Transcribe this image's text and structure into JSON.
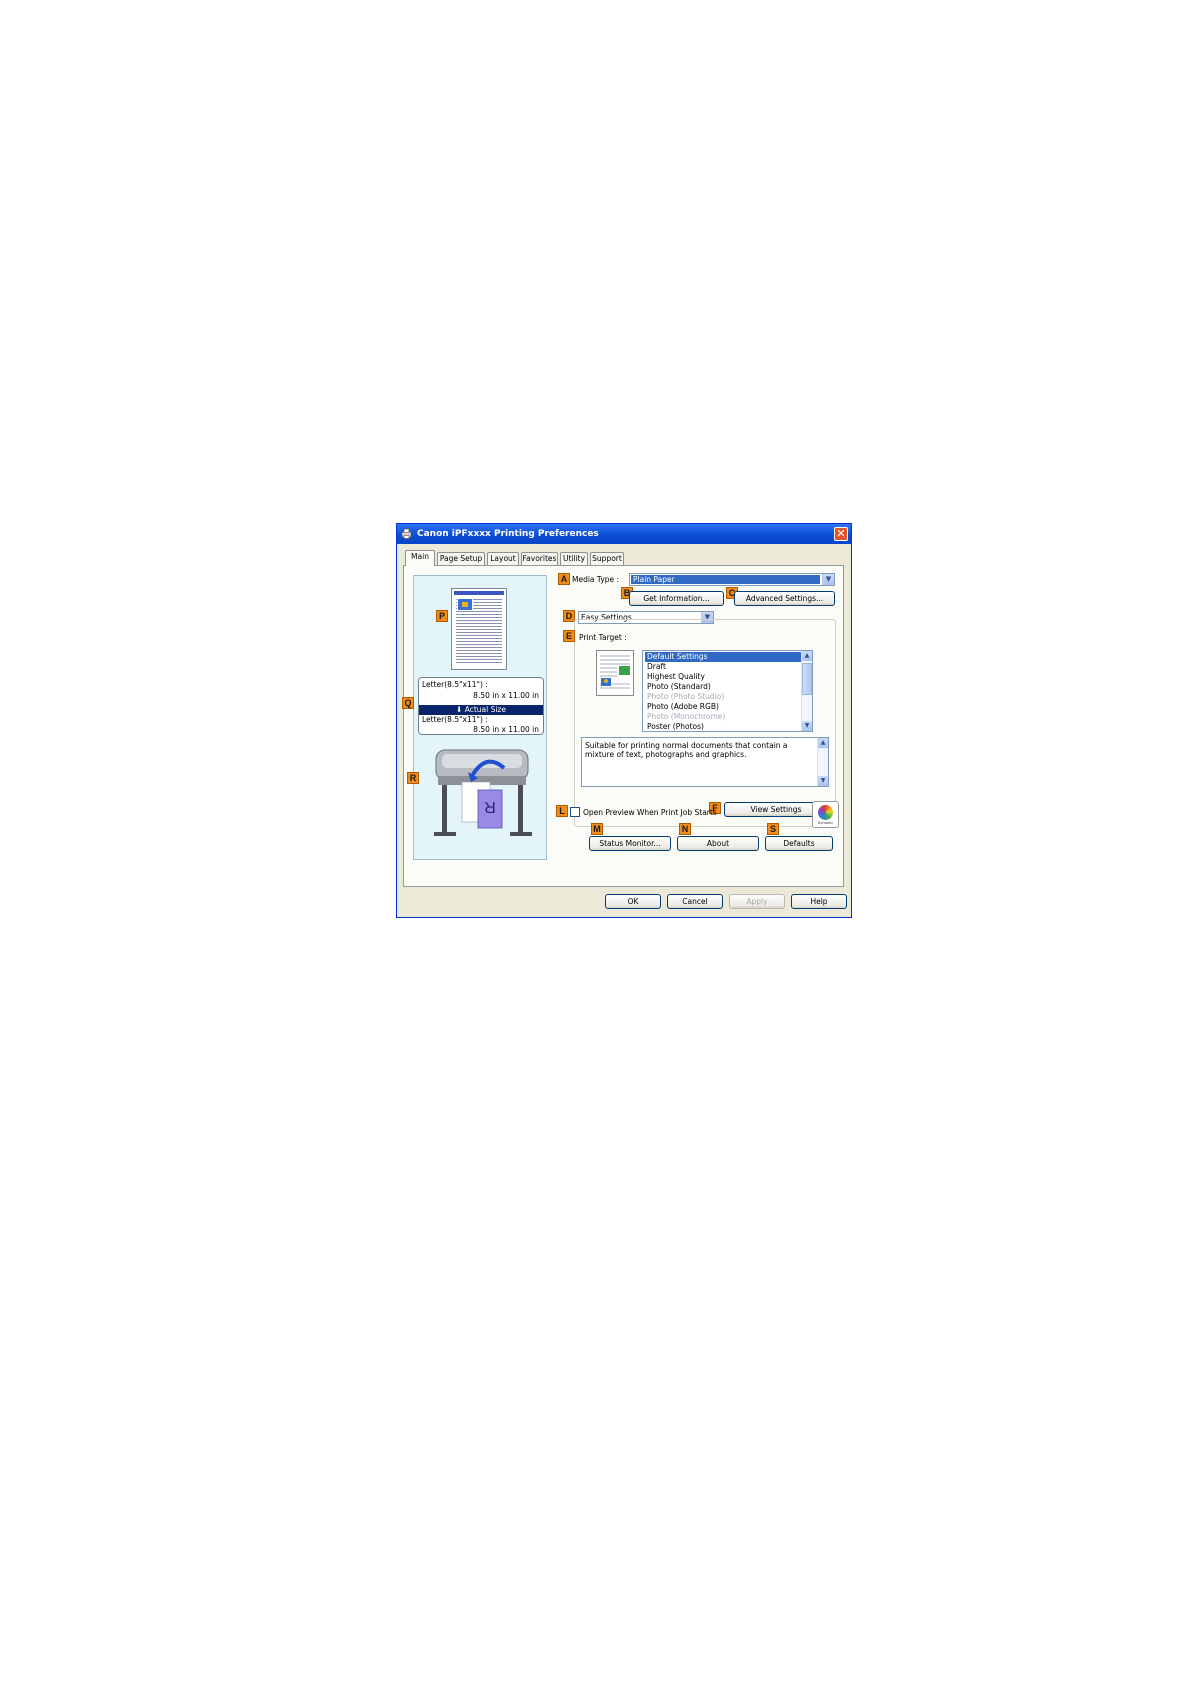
{
  "window": {
    "title": "Canon iPFxxxx Printing Preferences",
    "close_glyph": "✕"
  },
  "tabs": [
    {
      "label": "Main"
    },
    {
      "label": "Page Setup"
    },
    {
      "label": "Layout"
    },
    {
      "label": "Favorites"
    },
    {
      "label": "Utility"
    },
    {
      "label": "Support"
    }
  ],
  "markers": {
    "a": "A",
    "b": "B",
    "c": "C",
    "d": "D",
    "e": "E",
    "f": "F",
    "l": "L",
    "m": "M",
    "n": "N",
    "s": "S",
    "p": "P",
    "q": "Q",
    "r": "R"
  },
  "left_pane": {
    "original_size_label": "Letter(8.5\"x11\") :",
    "original_size_value": "8.50 in x 11.00 in",
    "scaling_label": "Actual Size",
    "scaling_arrow": "⬇",
    "output_size_label": "Letter(8.5\"x11\") :",
    "output_size_value": "8.50 in x 11.00 in",
    "printer_letter": "R"
  },
  "media_type": {
    "label": "Media Type :",
    "value": "Plain Paper"
  },
  "buttons": {
    "get_information": "Get Information...",
    "advanced_settings": "Advanced Settings...",
    "view_settings": "View Settings",
    "status_monitor": "Status Monitor...",
    "about": "About",
    "defaults": "Defaults",
    "ok": "OK",
    "cancel": "Cancel",
    "apply": "Apply",
    "help": "Help"
  },
  "mode": {
    "value": "Easy Settings"
  },
  "print_target": {
    "label": "Print Target :",
    "items": [
      {
        "label": "Default Settings",
        "state": "selected"
      },
      {
        "label": "Draft",
        "state": "normal"
      },
      {
        "label": "Highest Quality",
        "state": "normal"
      },
      {
        "label": "Photo (Standard)",
        "state": "normal"
      },
      {
        "label": "Photo (Photo Studio)",
        "state": "disabled"
      },
      {
        "label": "Photo (Adobe RGB)",
        "state": "normal"
      },
      {
        "label": "Photo (Monochrome)",
        "state": "disabled"
      },
      {
        "label": "Poster (Photos)",
        "state": "normal"
      }
    ],
    "description": "Suitable for printing normal documents that contain a mixture of text, photographs and graphics."
  },
  "preview": {
    "checkbox_label": "Open Preview When Print Job Starts",
    "checked": false
  },
  "color_icon": {
    "caption": "Dynamic"
  },
  "scroll_glyphs": {
    "up": "▲",
    "down": "▼",
    "combo": "▼"
  }
}
